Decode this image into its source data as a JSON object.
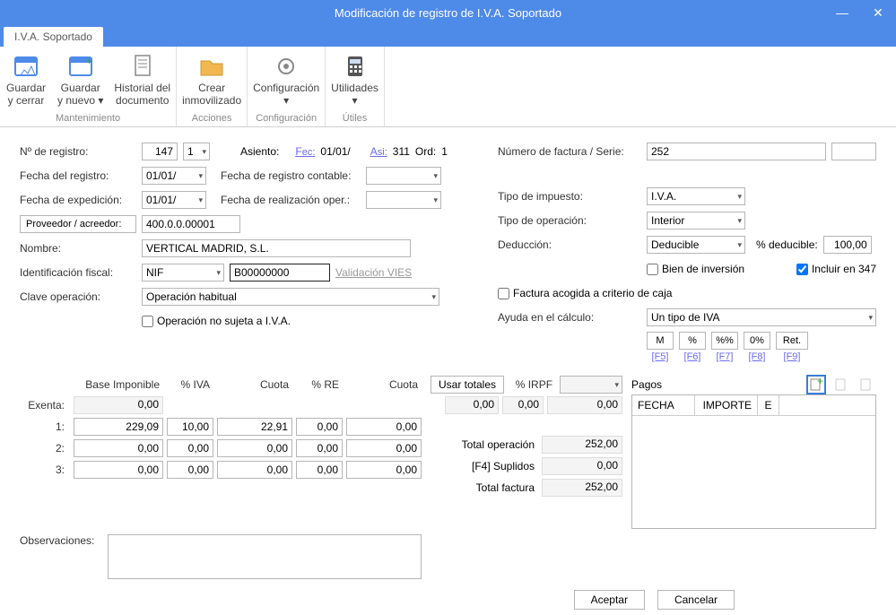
{
  "window": {
    "title": "Modificación de registro de I.V.A. Soportado"
  },
  "tab": {
    "label": "I.V.A. Soportado"
  },
  "ribbon": {
    "groups": [
      {
        "label": "Mantenimiento",
        "items": [
          {
            "key": "save-close",
            "l1": "Guardar",
            "l2": "y cerrar"
          },
          {
            "key": "save-new",
            "l1": "Guardar",
            "l2": "y nuevo ▾"
          },
          {
            "key": "doc-history",
            "l1": "Historial del",
            "l2": "documento"
          }
        ]
      },
      {
        "label": "Acciones",
        "items": [
          {
            "key": "create-asset",
            "l1": "Crear",
            "l2": "inmovilizado"
          }
        ]
      },
      {
        "label": "Configuración",
        "items": [
          {
            "key": "config",
            "l1": "Configuración",
            "l2": "▾"
          }
        ]
      },
      {
        "label": "Útiles",
        "items": [
          {
            "key": "utils",
            "l1": "Utilidades",
            "l2": "▾"
          }
        ]
      }
    ]
  },
  "left": {
    "nregistro_label": "Nº de registro:",
    "nregistro": "147",
    "nregistro_sub": "1",
    "asiento_label": "Asiento:",
    "asiento_fec_label": "Fec:",
    "asiento_fec": "01/01/",
    "asiento_asi_label": "Asi:",
    "asiento_asi": "311",
    "asiento_ord_label": "Ord:",
    "asiento_ord": "1",
    "freg_label": "Fecha del registro:",
    "freg": "01/01/",
    "fcont_label": "Fecha de registro contable:",
    "fcont": "",
    "fexp_label": "Fecha de expedición:",
    "fexp": "01/01/",
    "frop_label": "Fecha de realización oper.:",
    "frop": "",
    "prov_btn": "Proveedor / acreedor:",
    "prov": "400.0.0.00001",
    "nombre_label": "Nombre:",
    "nombre": "VERTICAL MADRID, S.L.",
    "idfiscal_label": "Identificación fiscal:",
    "idfiscal_type": "NIF",
    "idfiscal_val": "B00000000",
    "vies": "Validación VIES",
    "clave_label": "Clave operación:",
    "clave": "Operación habitual",
    "op_no_iva": "Operación no sujeta a I.V.A."
  },
  "right": {
    "numfact_label": "Número de factura / Serie:",
    "numfact": "252",
    "serie": "",
    "tipoimp_label": "Tipo de impuesto:",
    "tipoimp": "I.V.A.",
    "tipoop_label": "Tipo de operación:",
    "tipoop": "Interior",
    "deducc_label": "Deducción:",
    "deducc": "Deducible",
    "pctded_label": "% deducible:",
    "pctded": "100,00",
    "bien_inv": "Bien de inversión",
    "incluir347": "Incluir en 347",
    "fact_caja": "Factura acogida a criterio de caja",
    "ayuda_label": "Ayuda en el cálculo:",
    "ayuda": "Un tipo de IVA",
    "calc": [
      "M",
      "%",
      "%%",
      "0%",
      "Ret."
    ],
    "calc_sc": [
      "[F5]",
      "[F6]",
      "[F7]",
      "[F8]",
      "[F9]"
    ]
  },
  "grid": {
    "headers": {
      "base": "Base Imponible",
      "iva": "% IVA",
      "cuota": "Cuota",
      "re": "% RE",
      "cuota2": "Cuota"
    },
    "usar": "Usar totales",
    "irpf_label": "% IRPF",
    "rows": {
      "exenta": {
        "label": "Exenta:",
        "base": "0,00"
      },
      "r1": {
        "label": "1:",
        "base": "229,09",
        "iva": "10,00",
        "cuota": "22,91",
        "re": "0,00",
        "cuota2": "0,00"
      },
      "r2": {
        "label": "2:",
        "base": "0,00",
        "iva": "0,00",
        "cuota": "0,00",
        "re": "0,00",
        "cuota2": "0,00"
      },
      "r3": {
        "label": "3:",
        "base": "0,00",
        "iva": "0,00",
        "cuota": "0,00",
        "re": "0,00",
        "cuota2": "0,00"
      }
    },
    "irpf": {
      "a": "0,00",
      "b": "0,00",
      "c": "0,00"
    },
    "totals": {
      "totop_label": "Total operación",
      "totop": "252,00",
      "supl_label": "[F4] Suplidos",
      "supl": "0,00",
      "totfact_label": "Total factura",
      "totfact": "252,00"
    }
  },
  "pagos": {
    "title": "Pagos",
    "cols": {
      "fecha": "FECHA",
      "importe": "IMPORTE",
      "e": "E"
    }
  },
  "obs": {
    "label": "Observaciones:"
  },
  "footer": {
    "accept": "Aceptar",
    "cancel": "Cancelar"
  }
}
